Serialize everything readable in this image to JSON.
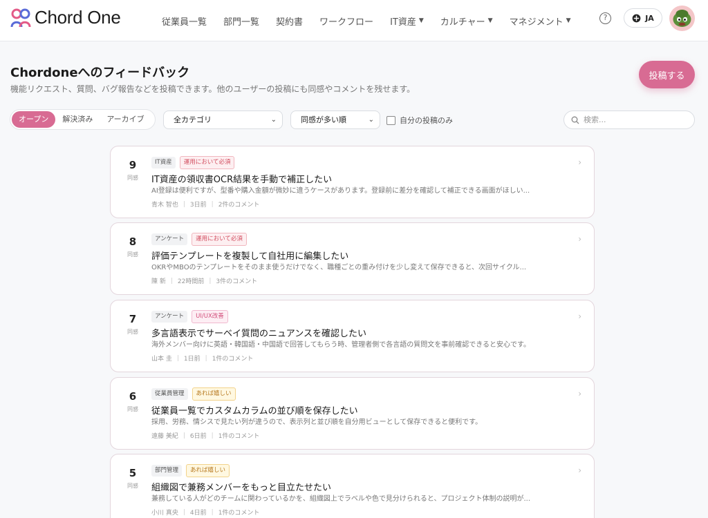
{
  "app": {
    "logo_text": "Chord One"
  },
  "nav": [
    {
      "label": "従業員一覧",
      "dropdown": false
    },
    {
      "label": "部門一覧",
      "dropdown": false
    },
    {
      "label": "契約書",
      "dropdown": false
    },
    {
      "label": "ワークフロー",
      "dropdown": false
    },
    {
      "label": "IT資産",
      "dropdown": true
    },
    {
      "label": "カルチャー",
      "dropdown": true
    },
    {
      "label": "マネジメント",
      "dropdown": true
    }
  ],
  "header": {
    "help_icon": "question-circle-icon",
    "lang_label": "JA",
    "lang_icon": "globe-icon"
  },
  "page": {
    "title": "Chordoneへのフィードバック",
    "subtitle": "機能リクエスト、質問、バグ報告などを投稿できます。他のユーザーの投稿にも同感やコメントを残せます。",
    "post_button": "投稿する"
  },
  "filters": {
    "status_tabs": [
      "オープン",
      "解決済み",
      "アーカイブ"
    ],
    "active_status": "オープン",
    "category_value": "全カテゴリ",
    "sort_value": "同感が多い順",
    "mine_only_label": "自分の投稿のみ",
    "mine_only_checked": false,
    "search_placeholder": "検索..."
  },
  "posts": [
    {
      "votes": "9",
      "vote_label": "同感",
      "category": "IT資産",
      "priority": "運用において必須",
      "priority_type": "must",
      "title": "IT資産の領収書OCR結果を手動で補正したい",
      "description": "AI登録は便利ですが、型番や購入金額が微妙に違うケースがあります。登録前に差分を確認して補正できる画面がほしい...",
      "author": "青木 智也",
      "time": "3日前",
      "comments": "2件のコメント"
    },
    {
      "votes": "8",
      "vote_label": "同感",
      "category": "アンケート",
      "priority": "運用において必須",
      "priority_type": "must",
      "title": "評価テンプレートを複製して自社用に編集したい",
      "description": "OKRやMBOのテンプレートをそのまま使うだけでなく、職種ごとの重み付けを少し変えて保存できると、次回サイクル...",
      "author": "陳 新",
      "time": "22時間前",
      "comments": "3件のコメント"
    },
    {
      "votes": "7",
      "vote_label": "同感",
      "category": "アンケート",
      "priority": "UI/UX改善",
      "priority_type": "uiux",
      "title": "多言語表示でサーベイ質問のニュアンスを確認したい",
      "description": "海外メンバー向けに英語・韓国語・中国語で回答してもらう時、管理者側で各言語の質問文を事前確認できると安心です。",
      "author": "山本 圭",
      "time": "1日前",
      "comments": "1件のコメント"
    },
    {
      "votes": "6",
      "vote_label": "同感",
      "category": "従業員管理",
      "priority": "あれば嬉しい",
      "priority_type": "nice",
      "title": "従業員一覧でカスタムカラムの並び順を保存したい",
      "description": "採用、労務、情シスで見たい列が違うので、表示列と並び順を自分用ビューとして保存できると便利です。",
      "author": "遠藤 美紀",
      "time": "6日前",
      "comments": "1件のコメント"
    },
    {
      "votes": "5",
      "vote_label": "同感",
      "category": "部門管理",
      "priority": "あれば嬉しい",
      "priority_type": "nice",
      "title": "組織図で兼務メンバーをもっと目立たせたい",
      "description": "兼務している人がどのチームに関わっているかを、組織図上でラベルや色で見分けられると、プロジェクト体制の説明が...",
      "author": "小川 真央",
      "time": "4日前",
      "comments": "1件のコメント"
    }
  ],
  "colors": {
    "accent": "#d86b93",
    "background": "#f7f8fa"
  }
}
